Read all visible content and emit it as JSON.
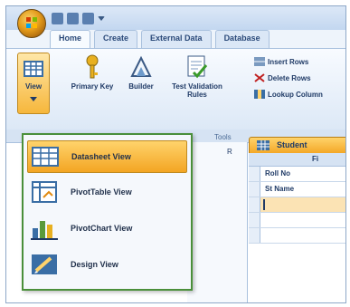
{
  "ribbon": {
    "tabs": [
      "Home",
      "Create",
      "External Data",
      "Database"
    ],
    "view_label": "View",
    "primary_key": "Primary Key",
    "builder": "Builder",
    "test_validation": "Test Validation Rules",
    "insert_rows": "Insert Rows",
    "delete_rows": "Delete Rows",
    "lookup_column": "Lookup Column",
    "group_tools": "Tools"
  },
  "view_menu": {
    "items": [
      "Datasheet View",
      "PivotTable View",
      "PivotChart View",
      "Design View"
    ]
  },
  "document": {
    "tab_title": "Student",
    "field_header": "Fi",
    "rows": [
      "Roll No",
      "St Name"
    ],
    "left_label": "R"
  },
  "colors": {
    "accent": "#f3a523",
    "ribbon": "#dce8f6",
    "menu_border": "#4a8f3a"
  }
}
